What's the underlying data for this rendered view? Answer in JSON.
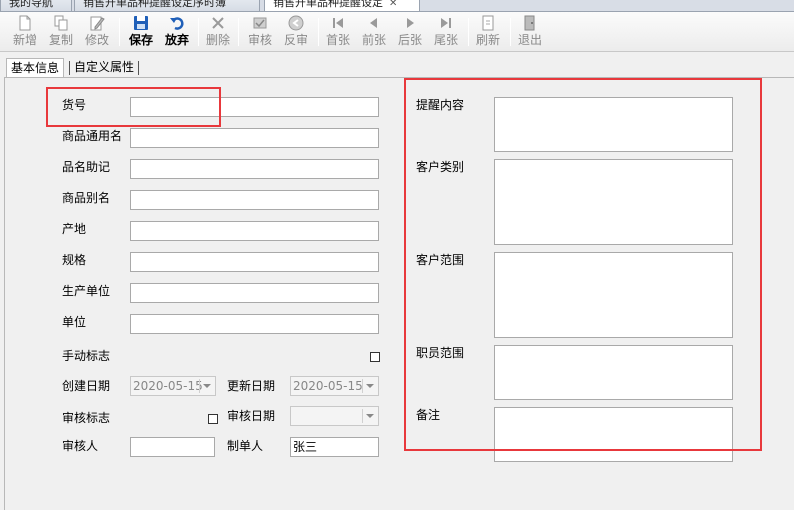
{
  "tabs": [
    {
      "label": "我的导航",
      "active": false,
      "closable": false
    },
    {
      "label": "销售开单品种提醒设定序时簿",
      "active": false,
      "closable": false
    },
    {
      "label": "销售开单品种提醒设定",
      "active": true,
      "closable": true
    }
  ],
  "toolbar": {
    "new": "新增",
    "copy": "复制",
    "modify": "修改",
    "save": "保存",
    "discard": "放弃",
    "delete": "删除",
    "audit": "审核",
    "unaudit": "反审",
    "first": "首张",
    "prev": "前张",
    "next": "后张",
    "last": "尾张",
    "refresh": "刷新",
    "exit": "退出"
  },
  "subtabs": {
    "basic": "基本信息",
    "custom": "自定义属性"
  },
  "form": {
    "item_no": {
      "label": "货号",
      "value": ""
    },
    "generic_name": {
      "label": "商品通用名",
      "value": ""
    },
    "mnemonic": {
      "label": "品名助记",
      "value": ""
    },
    "alias": {
      "label": "商品别名",
      "value": ""
    },
    "origin": {
      "label": "产地",
      "value": ""
    },
    "spec": {
      "label": "规格",
      "value": ""
    },
    "manufacturer": {
      "label": "生产单位",
      "value": ""
    },
    "unit": {
      "label": "单位",
      "value": ""
    },
    "manual_flag": {
      "label": "手动标志",
      "checked": false
    },
    "created_date": {
      "label": "创建日期",
      "value": "2020-05-15"
    },
    "updated_date": {
      "label": "更新日期",
      "value": "2020-05-15"
    },
    "audit_flag": {
      "label": "审核标志",
      "checked": false
    },
    "audit_date": {
      "label": "审核日期",
      "value": ""
    },
    "auditor": {
      "label": "审核人",
      "value": ""
    },
    "creator": {
      "label": "制单人",
      "value": "张三"
    },
    "reminder_content": {
      "label": "提醒内容",
      "value": ""
    },
    "customer_category": {
      "label": "客户类别",
      "value": ""
    },
    "customer_scope": {
      "label": "客户范围",
      "value": ""
    },
    "staff_scope": {
      "label": "职员范围",
      "value": ""
    },
    "remarks": {
      "label": "备注",
      "value": ""
    }
  },
  "colors": {
    "highlight": "#e8383c",
    "save_icon": "#1f5fb8",
    "discard_icon": "#1f5fb8"
  }
}
